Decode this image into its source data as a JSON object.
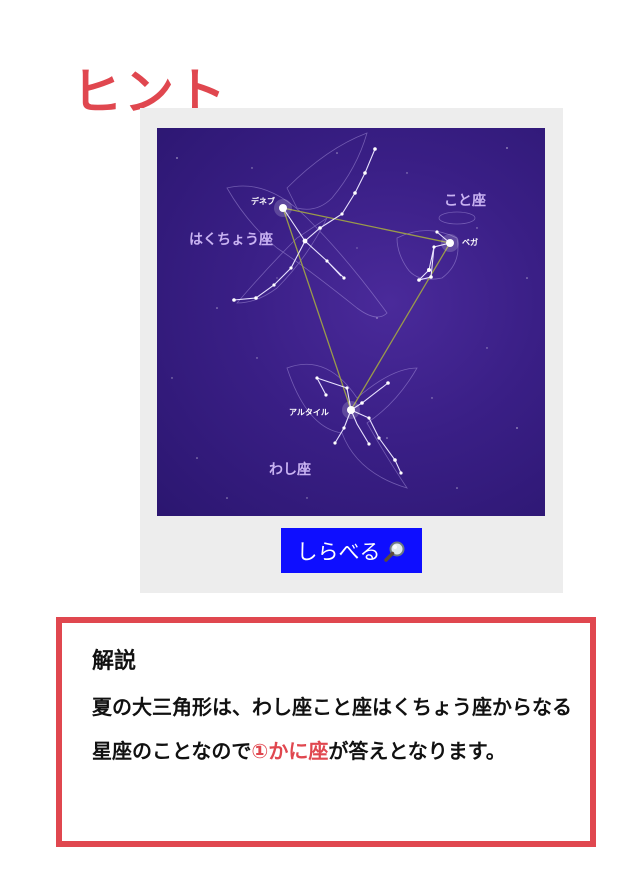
{
  "hint": {
    "title": "ヒント"
  },
  "figure": {
    "constellations": {
      "cygnus": "はくちょう座",
      "lyra": "こと座",
      "aquila": "わし座"
    },
    "stars": {
      "deneb": "デネブ",
      "vega": "ベガ",
      "altair": "アルタイル"
    },
    "button_label": "しらべる",
    "button_icon": "magnifier-icon",
    "colors": {
      "sky": "#3a1f86",
      "triangle": "#9a9a4a",
      "button": "#0e0eff"
    }
  },
  "explanation": {
    "title": "解説",
    "text_before": "夏の大三角形は、わし座こと座はくちょう座からなる星座のことなので",
    "answer": "①かに座",
    "text_after": "が答えとなります。",
    "accent_color": "#e0474f"
  }
}
